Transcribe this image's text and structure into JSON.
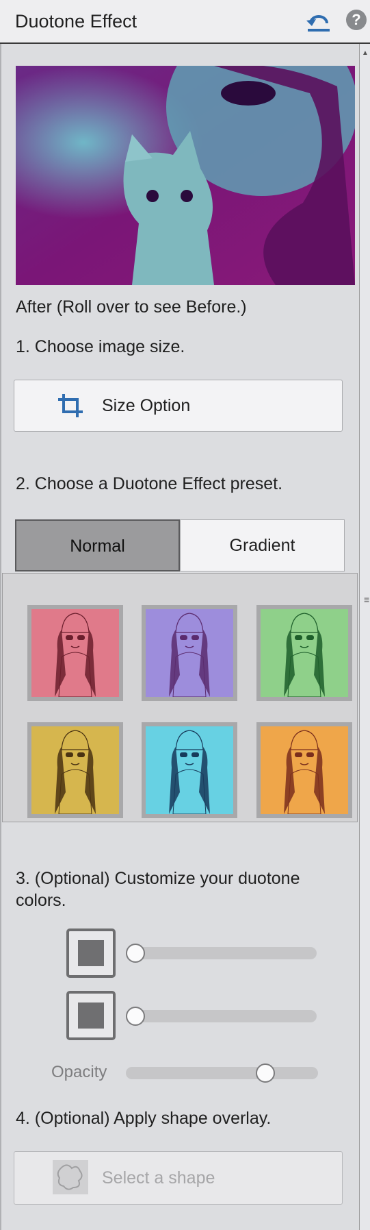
{
  "header": {
    "title": "Duotone Effect",
    "undo_icon": "undo-icon",
    "help_label": "?"
  },
  "preview": {
    "caption": "After (Roll over to see Before.)"
  },
  "step1": {
    "label": "1. Choose image size.",
    "button_label": "Size Option",
    "icon": "crop-icon"
  },
  "step2": {
    "label": "2. Choose a Duotone Effect preset.",
    "tabs": [
      {
        "label": "Normal",
        "selected": true
      },
      {
        "label": "Gradient",
        "selected": false
      }
    ],
    "presets": [
      {
        "name": "red",
        "light": "#e07a8a",
        "dark": "#6a1e2c"
      },
      {
        "name": "purple",
        "light": "#9d8ddc",
        "dark": "#5b2b6e"
      },
      {
        "name": "green",
        "light": "#8fd08a",
        "dark": "#1d5e2a"
      },
      {
        "name": "yellow",
        "light": "#d6b64e",
        "dark": "#4a3312"
      },
      {
        "name": "cyan",
        "light": "#67d1e3",
        "dark": "#173a5a"
      },
      {
        "name": "orange",
        "light": "#efa64a",
        "dark": "#7a2e1c"
      }
    ]
  },
  "step3": {
    "label": "3. (Optional) Customize your duotone colors.",
    "color1_level": 0,
    "color2_level": 0,
    "opacity_label": "Opacity",
    "opacity_level": 0.75
  },
  "step4": {
    "label": "4. (Optional) Apply shape overlay.",
    "button_label": "Select a shape"
  },
  "colors": {
    "accent": "#2f6db0",
    "preview_dark": "#7a1677",
    "preview_light": "#6fc7cf"
  }
}
